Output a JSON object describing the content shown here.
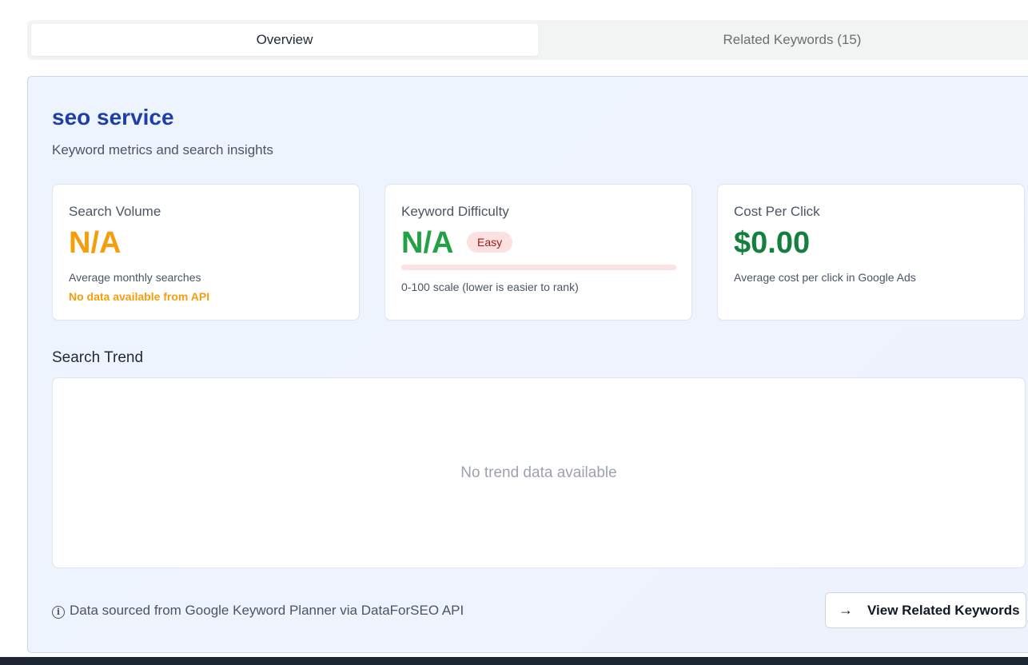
{
  "tabs": [
    {
      "label": "Overview",
      "active": true
    },
    {
      "label": "Related Keywords (15)",
      "active": false
    }
  ],
  "keyword": {
    "title": "seo service",
    "subtitle": "Keyword metrics and search insights"
  },
  "cards": {
    "volume": {
      "label": "Search Volume",
      "value": "N/A",
      "description": "Average monthly searches",
      "note": "No data available from API"
    },
    "difficulty": {
      "label": "Keyword Difficulty",
      "value": "N/A",
      "badge": "Easy",
      "bar_fill_percent": 0,
      "description": "0-100 scale (lower is easier to rank)"
    },
    "cpc": {
      "label": "Cost Per Click",
      "value": "$0.00",
      "description": "Average cost per click in Google Ads"
    }
  },
  "trend": {
    "title": "Search Trend",
    "empty_message": "No trend data available"
  },
  "footer": {
    "info_icon": "info-circle-icon",
    "source_note": "Data sourced from Google Keyword Planner via DataForSEO API",
    "button_icon": "arrow-right-icon",
    "button_label": "View Related Keywords"
  },
  "colors": {
    "title": "#1d3fa6",
    "volume": "#f59e0b",
    "difficulty": "#22a145",
    "cpc": "#15803d",
    "badge_bg": "#fde0e0",
    "badge_text": "#991b1b"
  }
}
